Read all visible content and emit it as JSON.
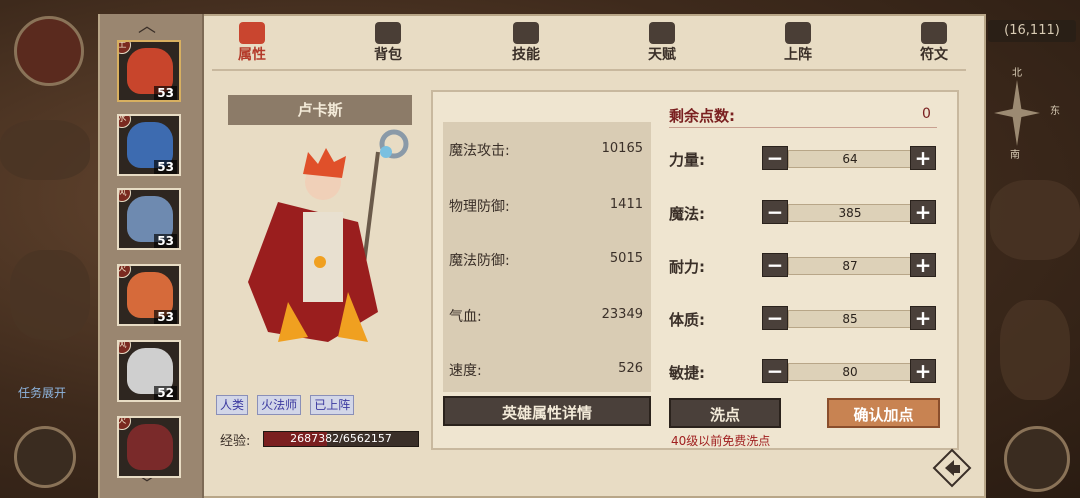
{
  "tabs": [
    {
      "label": "属性",
      "icon": "flame-icon",
      "active": true
    },
    {
      "label": "背包",
      "icon": "bag-icon"
    },
    {
      "label": "技能",
      "icon": "book-icon"
    },
    {
      "label": "天赋",
      "icon": "eye-icon"
    },
    {
      "label": "上阵",
      "icon": "crossed-swords-icon"
    },
    {
      "label": "符文",
      "icon": "rune-icon"
    }
  ],
  "roster": [
    {
      "level": "53",
      "badge": "土",
      "color": "#c8452c"
    },
    {
      "level": "53",
      "badge": "水",
      "color": "#3d6bb0"
    },
    {
      "level": "53",
      "badge": "风",
      "color": "#6e8ab0"
    },
    {
      "level": "53",
      "badge": "火",
      "color": "#d66a3a"
    },
    {
      "level": "52",
      "badge": "风",
      "color": "#cfcfcf"
    },
    {
      "level": "",
      "badge": "火",
      "color": "#7a2a2a"
    }
  ],
  "hero": {
    "name": "卢卡斯",
    "tags": [
      "人类",
      "火法师",
      "已上阵"
    ],
    "exp_label": "经验:",
    "exp_text": "2687382/6562157",
    "exp_fraction": 0.41
  },
  "stats": [
    {
      "name": "魔法攻击:",
      "value": "10165"
    },
    {
      "name": "物理防御:",
      "value": "1411"
    },
    {
      "name": "魔法防御:",
      "value": "5015"
    },
    {
      "name": "气血:",
      "value": "23349"
    },
    {
      "name": "速度:",
      "value": "526"
    }
  ],
  "points": {
    "label": "剩余点数:",
    "value": "0"
  },
  "attributes": [
    {
      "name": "力量:",
      "value": "64"
    },
    {
      "name": "魔法:",
      "value": "385"
    },
    {
      "name": "耐力:",
      "value": "87"
    },
    {
      "name": "体质:",
      "value": "85"
    },
    {
      "name": "敏捷:",
      "value": "80"
    }
  ],
  "buttons": {
    "details": "英雄属性详情",
    "reset": "洗点",
    "confirm": "确认加点"
  },
  "hint": "40级以前免费洗点",
  "side_text": "任务展开",
  "coords": "(16,111)",
  "compass": {
    "n": "北",
    "e": "东",
    "s": "南"
  }
}
